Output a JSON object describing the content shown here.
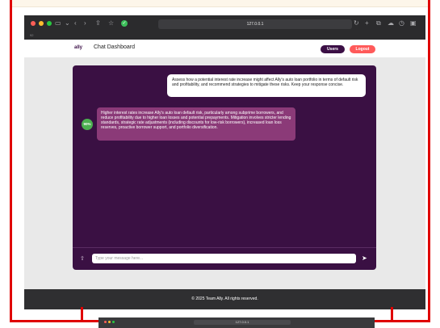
{
  "browser": {
    "url": "127.0.0.1",
    "subtab_label": "92"
  },
  "navbar": {
    "brand": "ally",
    "title": "Chat Dashboard",
    "users_label": "Users",
    "logout_label": "Logout"
  },
  "chat": {
    "user_message": "Assess how a potential interest rate increase might affect Ally's auto loan portfolio in terms of default risk and profitability, and recommend strategies to mitigate these risks. Keep your response concise.",
    "bot_avatar_label": "90%",
    "bot_message": "Higher interest rates increase Ally's auto loan default risk, particularly among subprime borrowers, and reduce profitability due to higher loan losses and potential prepayments. Mitigation involves stricter lending standards, strategic rate adjustments (including discounts for low-risk borrowers), increased loan loss reserves, proactive borrower support, and portfolio diversification.",
    "input_placeholder": "Type your message here..."
  },
  "footer": {
    "text": "© 2025 Team Ally. All rights reserved."
  },
  "thumbnail": {
    "url": "127.0.0.1"
  },
  "colors": {
    "chat_bg": "#3a1043",
    "bot_bubble": "#8b3a78",
    "users_button": "#3b0f45",
    "logout_button": "#ff5a5a",
    "avatar": "#4caf50",
    "frame": "#e00000"
  },
  "icons": [
    "sidebar-icon",
    "back-icon",
    "forward-icon",
    "share-icon",
    "bookmark-icon",
    "favicon-icon",
    "reload-icon",
    "new-tab-icon",
    "tabs-icon",
    "upload-icon",
    "send-icon"
  ]
}
